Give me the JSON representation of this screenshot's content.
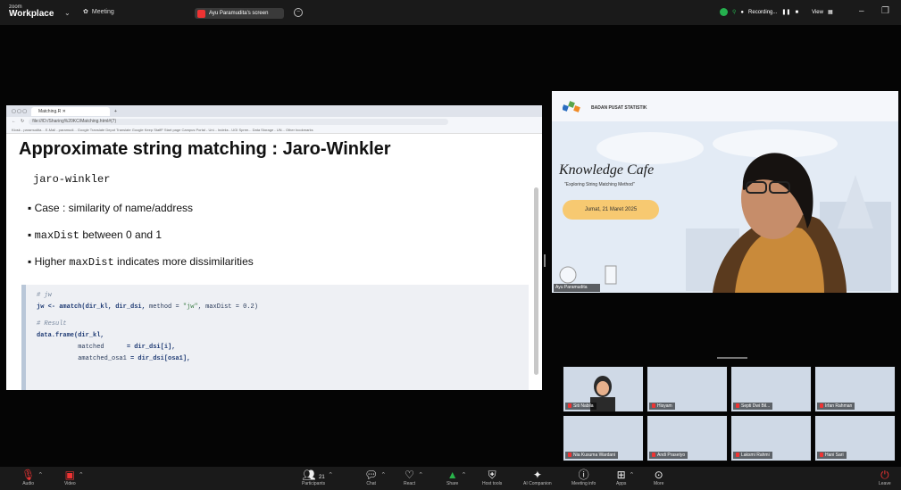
{
  "topbar": {
    "brand_small": "zoom",
    "brand_large": "Workplace",
    "meeting_label": "Meeting",
    "screen_share_label": "Ayu Paramudita's screen",
    "status_text": "Recording...",
    "view_label": "View"
  },
  "browser": {
    "tab_label": "Matching.R",
    "url": "file:///D:/Sharing%20KC/Matching.html#(7)",
    "bookmarks": "Kiosk - paramudita...   E-Mail - paramudi...   Google Translate   Depot Translate   Google Keep   StaffF Start page   Campus Portal - Uni...   Indeks - UGI Spree...   Data Storage - UN...   Other bookmarks"
  },
  "slide": {
    "title": "Approximate string matching : Jaro-Winkler",
    "subtitle": "jaro-winkler",
    "bullet1": "Case : similarity of name/address",
    "bullet2_code": "maxDist",
    "bullet2_rest": " between 0 and 1",
    "bullet3_pre": "Higher ",
    "bullet3_code": "maxDist",
    "bullet3_rest": " indicates more dissimilarities",
    "code": {
      "c1": "# jw",
      "l1a": "jw <- ",
      "l1b": "amatch(dir_kl, dir_dsi, ",
      "l1c": "method",
      "l1d": " = ",
      "l1e": "\"jw\"",
      "l1f": ", ",
      "l1g": "maxDist",
      "l1h": " = 0.2)",
      "c2": "# Result",
      "l2": "data.frame(dir_kl,",
      "l3a": "           matched     ",
      "l3b": " = dir_dsi[i],",
      "l4a": "           amatched_osa1",
      "l4b": " = dir_dsi[osa1],"
    }
  },
  "presenter": {
    "org": "BADAN PUSAT STATISTIK",
    "title": "Knowledge Cafe",
    "subtitle": "\"Exploring String Matching Method\"",
    "date": "Jumat, 21 Maret 2025",
    "name": "Ayu Paramudita"
  },
  "gallery": [
    {
      "name": "Siti Nabila"
    },
    {
      "name": "Hisyam"
    },
    {
      "name": "Septi Dwi Bil..."
    },
    {
      "name": "Irfan Rahman"
    },
    {
      "name": "Nia Kusuma Wardani"
    },
    {
      "name": "Andi Prasetyo"
    },
    {
      "name": "Laksmi Rahmi"
    },
    {
      "name": "Hani Sari"
    }
  ],
  "toolbar": {
    "audio": "Audio",
    "video": "Video",
    "participants": "Participants",
    "participants_count": "21",
    "chat": "Chat",
    "react": "React",
    "share": "Share",
    "host_tools": "Host tools",
    "ai_companion": "AI Companion",
    "meeting_info": "Meeting info",
    "apps": "Apps",
    "more": "More",
    "leave": "Leave"
  },
  "colors": {
    "recording_dot": "#25b04e",
    "alert_red": "#e33333",
    "share_green": "#29b34a",
    "date_pill": "#f7c971"
  }
}
